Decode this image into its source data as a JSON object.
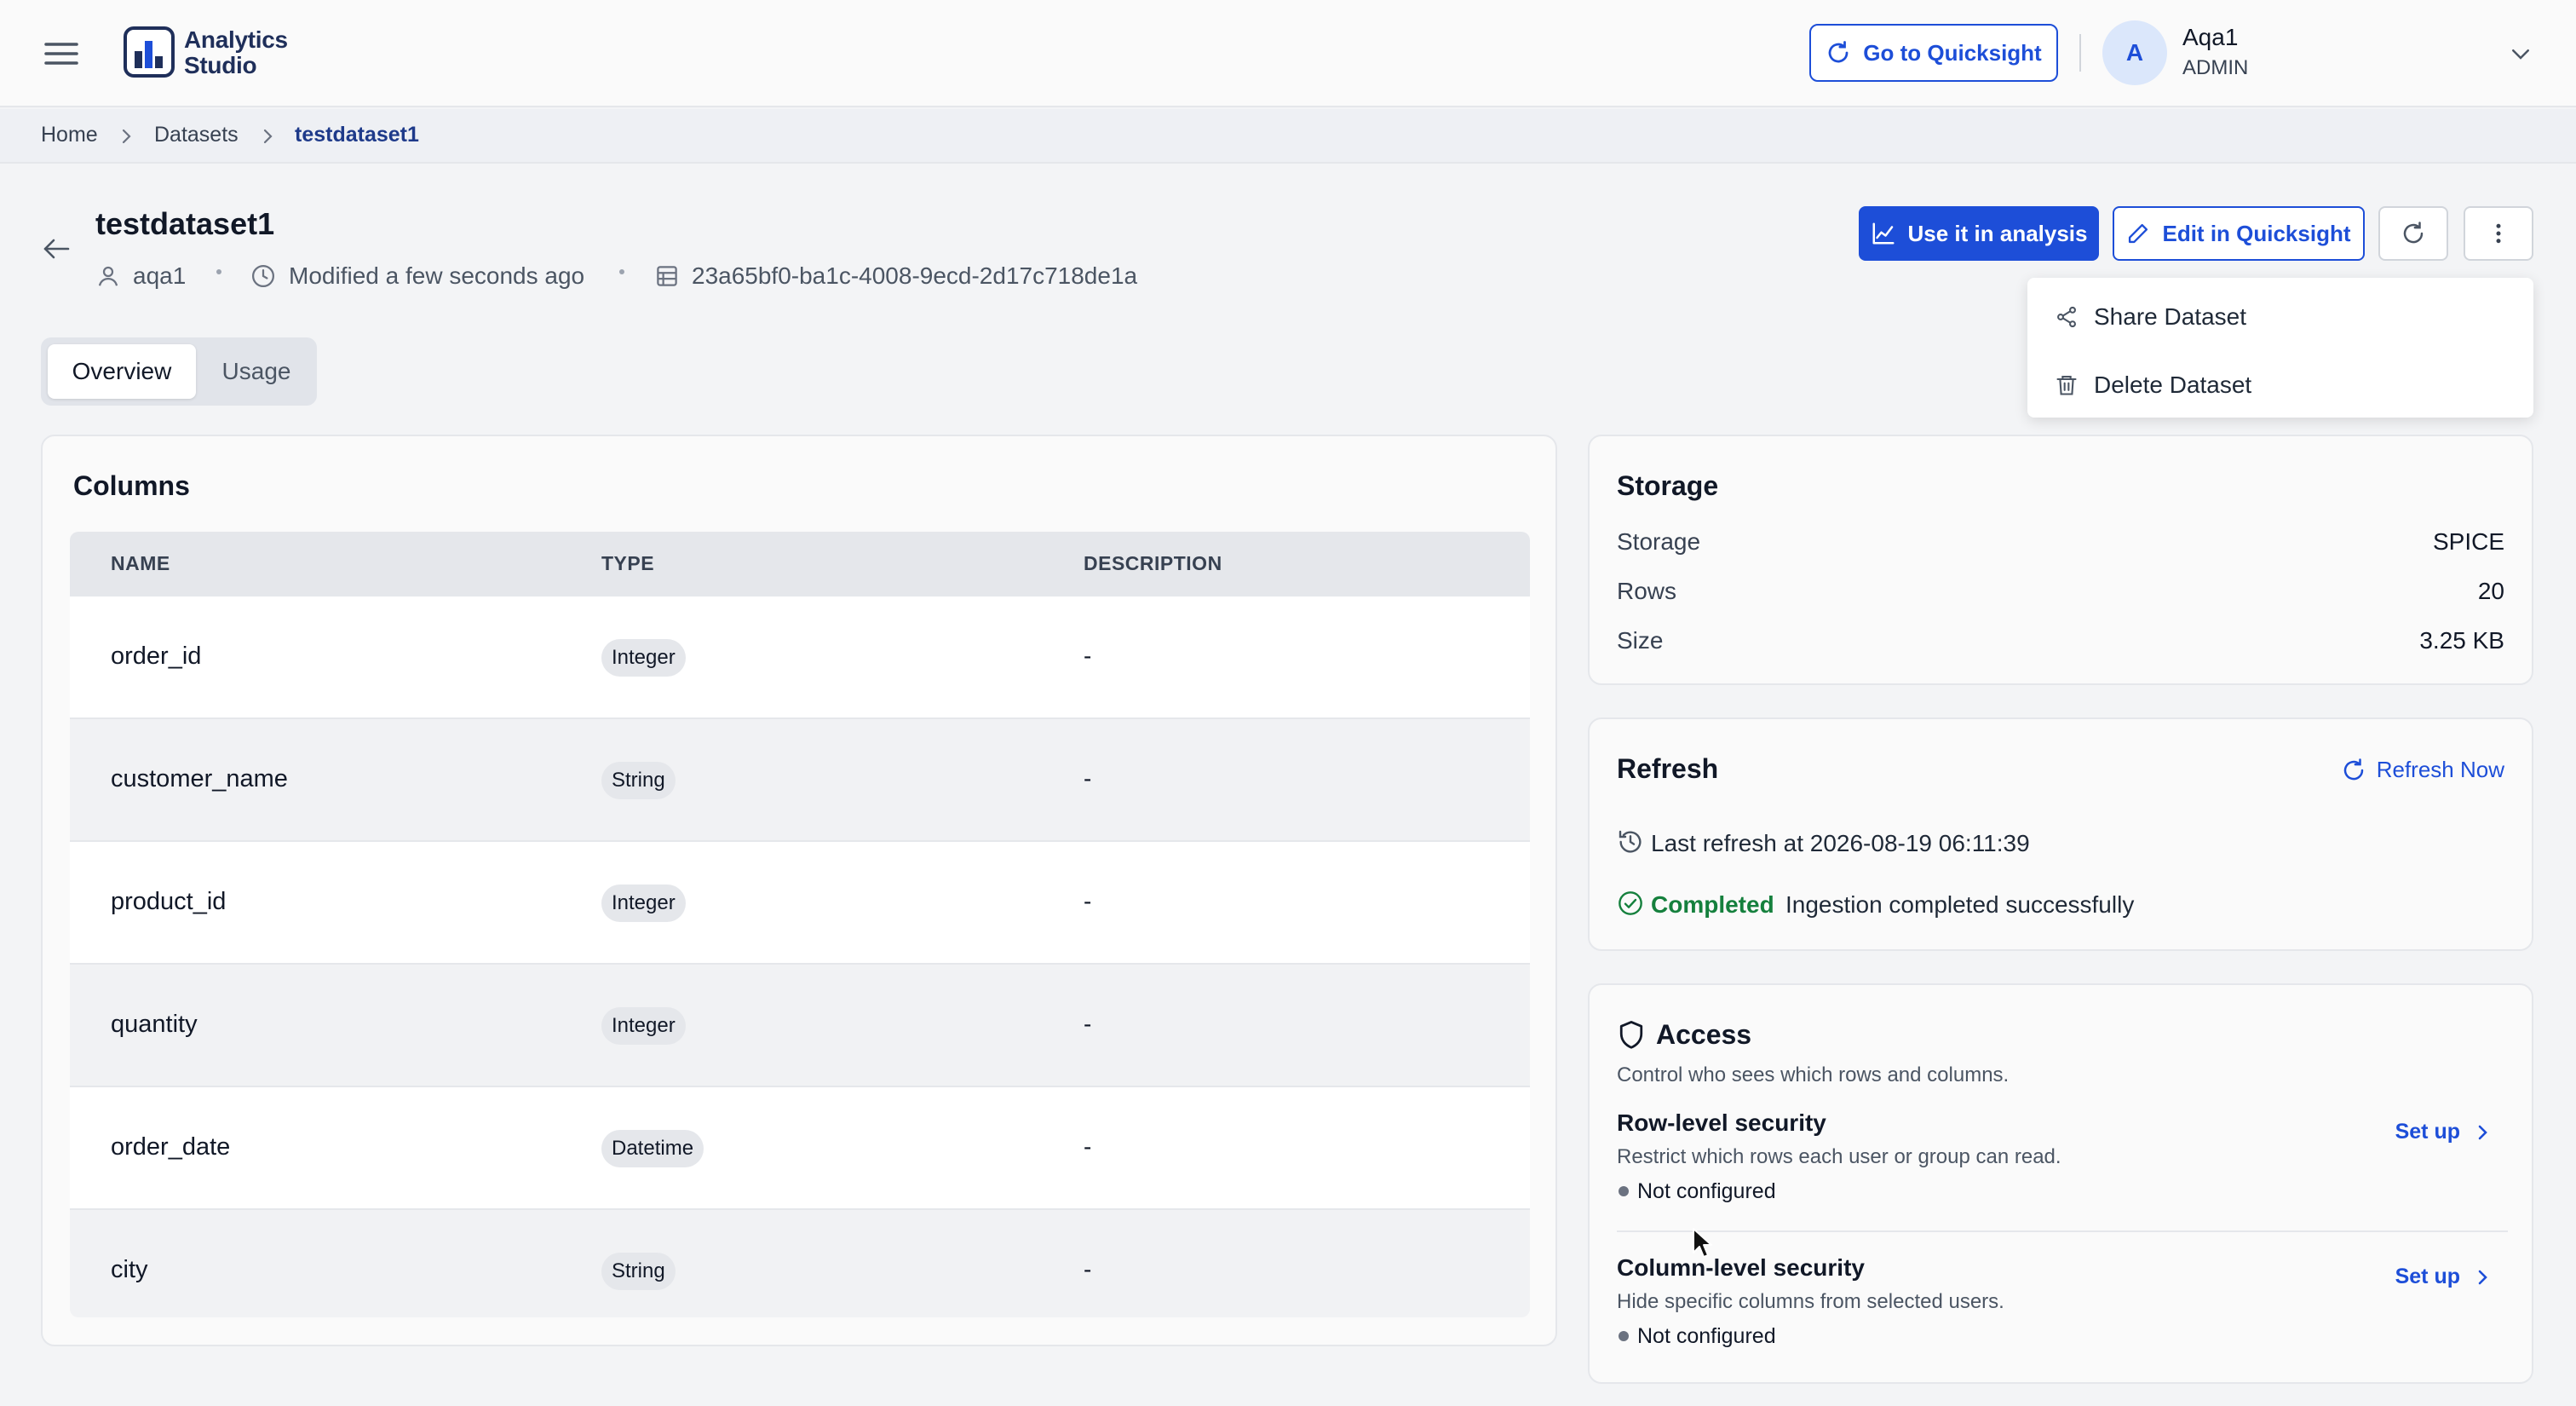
{
  "header": {
    "app_name": "Analytics\nStudio",
    "quicksight_button": "Go to Quicksight",
    "user": {
      "initial": "A",
      "name": "Aqa1",
      "role": "ADMIN"
    }
  },
  "breadcrumb": [
    "Home",
    "Datasets",
    "testdataset1"
  ],
  "dataset": {
    "title": "testdataset1",
    "owner": "aqa1",
    "modified": "Modified a few seconds ago",
    "id": "23a65bf0-ba1c-4008-9ecd-2d17c718de1a"
  },
  "actions": {
    "use_in_analysis": "Use it in analysis",
    "edit_in_quicksight": "Edit in Quicksight",
    "menu": [
      "Share Dataset",
      "Delete Dataset"
    ]
  },
  "tabs": [
    "Overview",
    "Usage"
  ],
  "columns_card": {
    "title": "Columns",
    "headers": [
      "NAME",
      "TYPE",
      "DESCRIPTION"
    ],
    "rows": [
      {
        "name": "order_id",
        "type": "Integer",
        "description": "-"
      },
      {
        "name": "customer_name",
        "type": "String",
        "description": "-"
      },
      {
        "name": "product_id",
        "type": "Integer",
        "description": "-"
      },
      {
        "name": "quantity",
        "type": "Integer",
        "description": "-"
      },
      {
        "name": "order_date",
        "type": "Datetime",
        "description": "-"
      },
      {
        "name": "city",
        "type": "String",
        "description": "-"
      }
    ]
  },
  "storage_card": {
    "title": "Storage",
    "items": [
      {
        "label": "Storage",
        "value": "SPICE"
      },
      {
        "label": "Rows",
        "value": "20"
      },
      {
        "label": "Size",
        "value": "3.25 KB"
      }
    ]
  },
  "refresh_card": {
    "title": "Refresh",
    "refresh_now": "Refresh Now",
    "last_refresh": "Last refresh at 2026-08-19 06:11:39",
    "status_label": "Completed",
    "status_text": "Ingestion completed successfully",
    "status_color": "#15803d"
  },
  "access_card": {
    "title": "Access",
    "subtitle": "Control who sees which rows and columns.",
    "row_level": {
      "title": "Row-level security",
      "description": "Restrict which rows each user or group can read.",
      "status": "Not configured",
      "action": "Set up"
    },
    "column_level": {
      "title": "Column-level security",
      "description": "Hide specific columns from selected users.",
      "status": "Not configured",
      "action": "Set up"
    }
  },
  "colors": {
    "primary": "#1d4ed8",
    "navy": "#1f2f5a"
  },
  "icons": [
    "menu-icon",
    "logo-icon",
    "refresh-icon",
    "chevron-down-icon",
    "chevron-right-icon",
    "arrow-left-icon",
    "user-icon",
    "clock-icon",
    "database-icon",
    "chart-icon",
    "pencil-icon",
    "more-vertical-icon",
    "share-icon",
    "trash-icon",
    "history-icon",
    "check-circle-icon",
    "shield-icon"
  ]
}
